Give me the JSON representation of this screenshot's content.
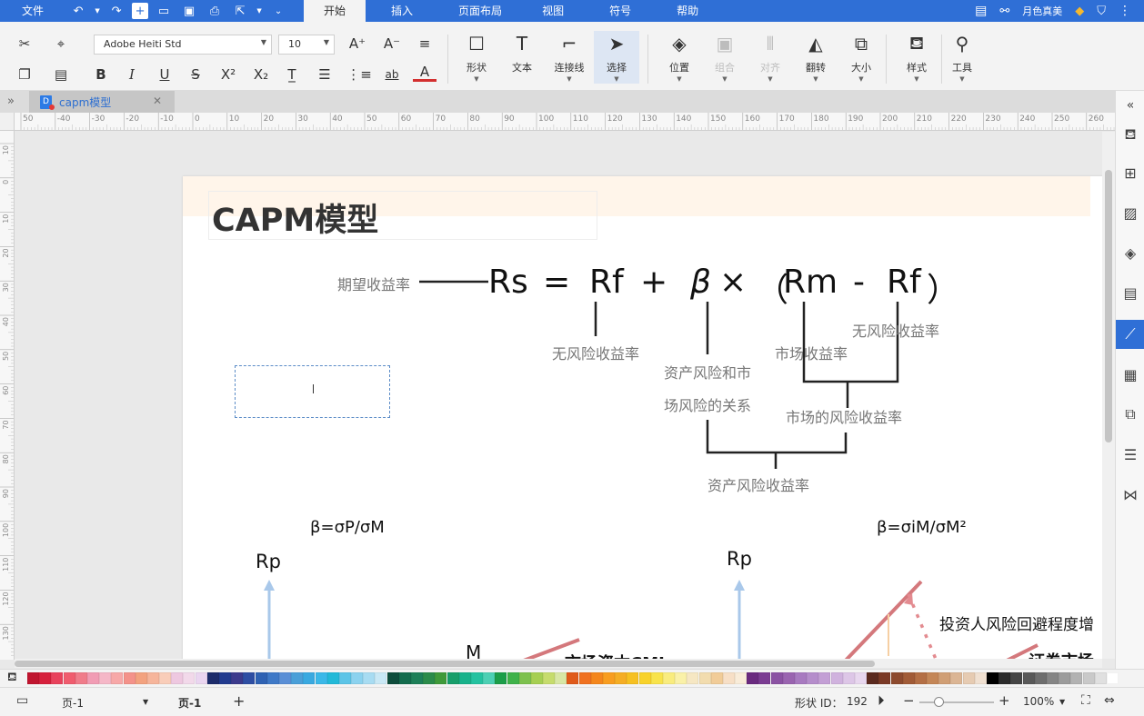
{
  "menubar": {
    "items": [
      "文件",
      "开始",
      "插入",
      "页面布局",
      "视图",
      "符号",
      "帮助"
    ],
    "active": "开始",
    "user": "月色真美"
  },
  "ribbon": {
    "font_name": "Adobe Heiti Std",
    "font_size": "10",
    "big_buttons": [
      {
        "key": "shape",
        "label": "形状",
        "icon": "square-icon"
      },
      {
        "key": "text",
        "label": "文本",
        "icon": "text-icon"
      },
      {
        "key": "connector",
        "label": "连接线",
        "icon": "connector-icon"
      },
      {
        "key": "select",
        "label": "选择",
        "icon": "cursor-icon"
      },
      {
        "key": "position",
        "label": "位置",
        "icon": "layers-icon"
      },
      {
        "key": "group",
        "label": "组合",
        "icon": "group-icon"
      },
      {
        "key": "align",
        "label": "对齐",
        "icon": "align-icon"
      },
      {
        "key": "flip",
        "label": "翻转",
        "icon": "flip-icon"
      },
      {
        "key": "size",
        "label": "大小",
        "icon": "size-icon"
      },
      {
        "key": "style",
        "label": "样式",
        "icon": "paint-bucket-icon"
      },
      {
        "key": "tools",
        "label": "工具",
        "icon": "tools-icon"
      }
    ]
  },
  "tab": {
    "name": "capm模型"
  },
  "ruler": {
    "h_labels": [
      "50",
      "-40",
      "-30",
      "-20",
      "-10",
      "0",
      "10",
      "20",
      "30",
      "40",
      "50",
      "60",
      "70",
      "80",
      "90",
      "100",
      "110",
      "120",
      "130",
      "140",
      "150",
      "160",
      "170",
      "180",
      "190",
      "200",
      "210",
      "220",
      "230",
      "240",
      "250",
      "260"
    ],
    "v_labels": [
      "10",
      "0",
      "10",
      "20",
      "30",
      "40",
      "50",
      "60",
      "70",
      "80",
      "90",
      "100",
      "110",
      "120",
      "130"
    ]
  },
  "diagram": {
    "title": "CAPM模型",
    "formula": {
      "rs": "Rs",
      "eq": "=",
      "rf": "Rf",
      "plus": "+",
      "beta": "β",
      "times": "×",
      "lparen": "（",
      "rm": "Rm",
      "minus": "-",
      "rf2": "Rf",
      "rparen": "）"
    },
    "labels": {
      "expected_return": "期望收益率",
      "riskfree_1": "无风险收益率",
      "asset_market_relation_1": "资产风险和市",
      "asset_market_relation_2": "场风险的关系",
      "market_return": "市场收益率",
      "riskfree_2": "无风险收益率",
      "market_risk_return": "市场的风险收益率",
      "asset_risk_return": "资产风险收益率"
    },
    "lower": {
      "beta_left": "β=σP/σM",
      "beta_right": "β=σiM/σM²",
      "rp_left": "Rp",
      "rp_right": "Rp",
      "m_label": "M",
      "cml_label": "市场资本CML",
      "investor_label": "投资人风险回避程度增",
      "sml_label": "证券市场"
    }
  },
  "palette": [
    "#c0152f",
    "#d6203c",
    "#e8425c",
    "#f05c6e",
    "#f07c8a",
    "#f19cb4",
    "#f5b7c7",
    "#f7a8a8",
    "#f4928a",
    "#f3a27f",
    "#f6b59b",
    "#f9cdb9",
    "#eec8e0",
    "#f2d9ea",
    "#ead5f0",
    "#1d2c6b",
    "#223b8f",
    "#3c3a8c",
    "#2e4ea3",
    "#2f62b3",
    "#3f79c7",
    "#5a8fd6",
    "#4a9fd8",
    "#39a9e0",
    "#3ab8e8",
    "#22b9d8",
    "#5cc4e7",
    "#8bd2ef",
    "#a8dcf2",
    "#c9e8f5",
    "#0d4c3b",
    "#136c4d",
    "#1d7f58",
    "#2b8b4a",
    "#3f9a3a",
    "#179e6a",
    "#18b28b",
    "#24c2a0",
    "#4dd0b4",
    "#1c9e49",
    "#3fb24a",
    "#7dc14e",
    "#a6cf52",
    "#c6dc6d",
    "#d8e7a5",
    "#e05a1a",
    "#f07120",
    "#f4861c",
    "#f89d1f",
    "#f5ad24",
    "#f6c021",
    "#f8d22a",
    "#f8e34b",
    "#f9ec7e",
    "#faf1a8",
    "#f6e7c3",
    "#f2dcae",
    "#f1cc98",
    "#f7dfc6",
    "#f9ecd9",
    "#6a2a7f",
    "#7b3c92",
    "#8b52a3",
    "#9a64b0",
    "#a87ac0",
    "#b58dcb",
    "#c39fd5",
    "#d0b2de",
    "#ddc6e7",
    "#e8d7ef",
    "#5b2a1f",
    "#7b3a26",
    "#8d4a2e",
    "#a15b37",
    "#b46f45",
    "#c48657",
    "#d09e74",
    "#dbb594",
    "#e6cbb2",
    "#f0e0d1",
    "#000000",
    "#2b2b2b",
    "#444444",
    "#595959",
    "#6e6e6e",
    "#858585",
    "#9b9b9b",
    "#b2b2b2",
    "#c9c9c9",
    "#e0e0e0",
    "#ffffff"
  ],
  "status": {
    "page_selector": "页-1",
    "page_tab": "页-1",
    "shape_id_label": "形状 ID：",
    "shape_id": "192",
    "zoom": "100%",
    "zoom_fraction": 0.25
  },
  "colors": {
    "brand": "#2f6fd6",
    "accent_line": "#d4787c",
    "arrow_blue": "#a9c8ea"
  }
}
